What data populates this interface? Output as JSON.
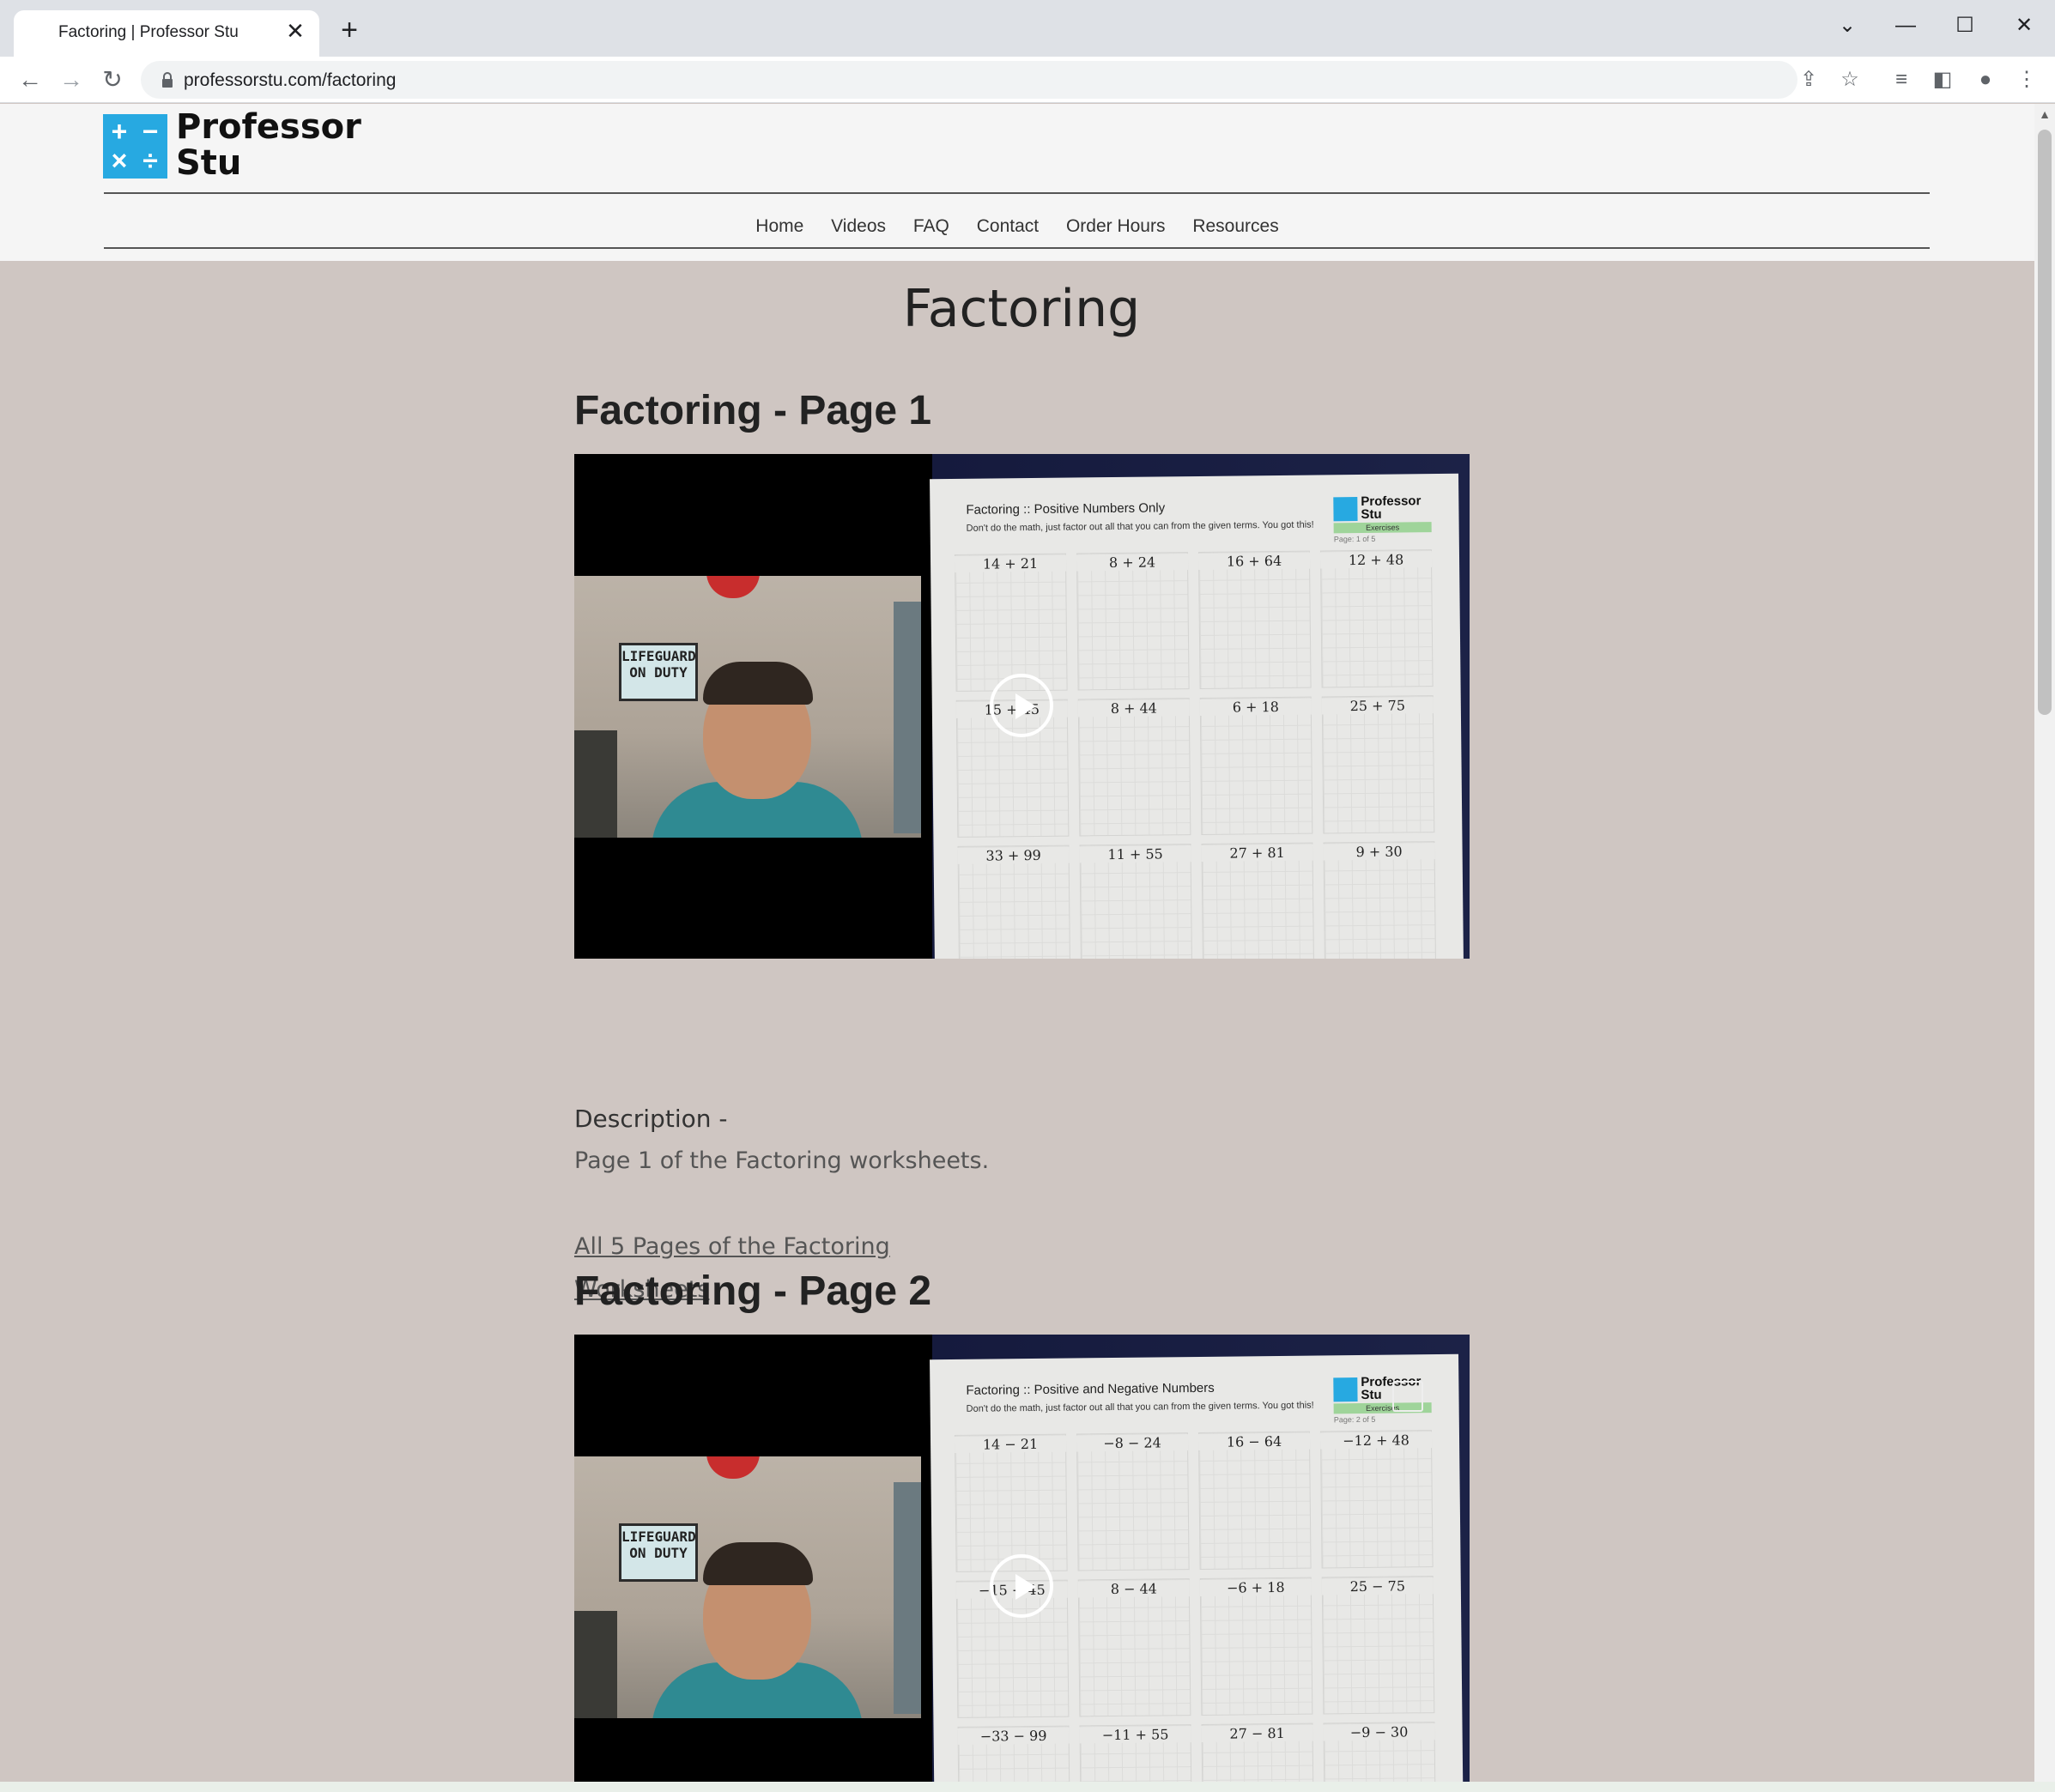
{
  "browser": {
    "tab_title": "Factoring | Professor Stu",
    "tab_close": "✕",
    "new_tab": "+",
    "url": "professorstu.com/factoring",
    "controls": {
      "dropdown": "⌄",
      "minimize": "—",
      "maximize": "☐",
      "close": "✕"
    }
  },
  "site": {
    "logo_line1": "Professor",
    "logo_line2": "Stu",
    "logo_symbols": [
      "+",
      "−",
      "×",
      "÷"
    ],
    "nav": [
      "Home",
      "Videos",
      "FAQ",
      "Contact",
      "Order Hours",
      "Resources"
    ]
  },
  "page": {
    "title": "Factoring",
    "sections": [
      {
        "title": "Factoring - Page 1",
        "video": {
          "sign": "LIFEGUARD ON DUTY",
          "sheet_title": "Factoring :: Positive Numbers Only",
          "sheet_sub": "Don't do the math, just factor out all that you can from the given terms. You got this!",
          "logo_line1": "Professor",
          "logo_line2": "Stu",
          "exercises": "Exercises",
          "page_of": "Page:   1   of   5",
          "problems": [
            "14 + 21",
            "8 + 24",
            "16 + 64",
            "12 + 48",
            "15 + 45",
            "8 + 44",
            "6 + 18",
            "25 + 75",
            "33 + 99",
            "11 + 55",
            "27 + 81",
            "9 + 30"
          ]
        },
        "description_label": "Description -",
        "description": "Page 1 of the Factoring worksheets.",
        "link_line1": "All 5 Pages of the Factoring",
        "link_line2": "Worksheets"
      },
      {
        "title": "Factoring - Page 2",
        "video": {
          "sign": "LIFEGUARD ON DUTY",
          "sheet_title": "Factoring :: Positive and Negative Numbers",
          "sheet_sub": "Don't do the math, just factor out all that you can from the given terms. You got this!",
          "logo_line1": "Professor",
          "logo_line2": "Stu",
          "exercises": "Exercises",
          "page_of": "Page:   2   of   5",
          "problems": [
            "14 − 21",
            "−8 − 24",
            "16 − 64",
            "−12 + 48",
            "−15 − 45",
            "8 − 44",
            "−6 + 18",
            "25 − 75",
            "−33 − 99",
            "−11 + 55",
            "27 − 81",
            "−9 − 30"
          ]
        }
      }
    ]
  },
  "colors": {
    "accent": "#27a9e1",
    "background": "#cfc6c2",
    "header_bg": "#f5f5f5"
  }
}
